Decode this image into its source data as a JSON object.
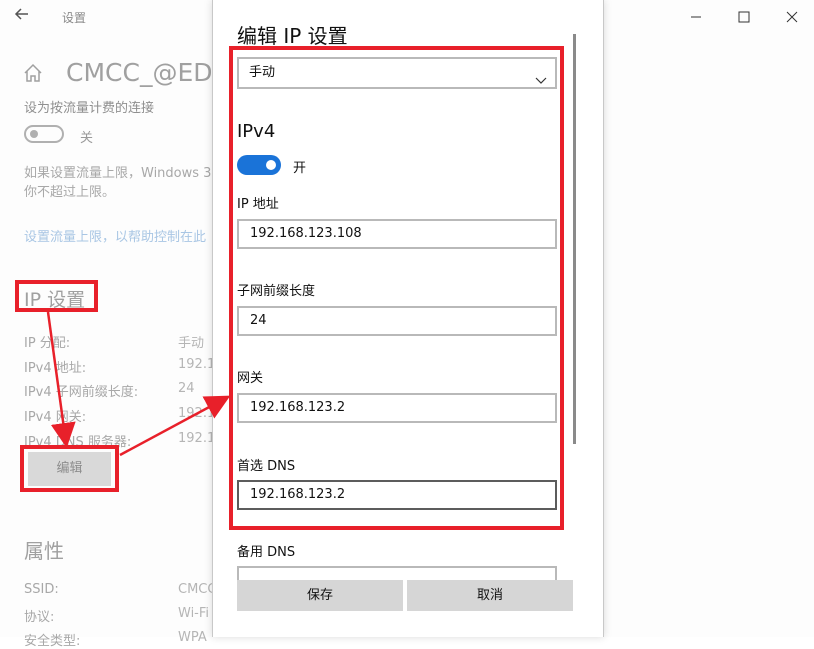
{
  "window": {
    "title": "设置",
    "back_icon": "back-arrow-icon"
  },
  "background": {
    "network_title": "CMCC_@ED",
    "metered": {
      "label": "设为按流量计费的连接",
      "toggle_text": "关"
    },
    "paragraph_lines": [
      "如果设置流量上限，Windows 3",
      "你不超过上限。"
    ],
    "link": "设置流量上限，以帮助控制在此",
    "ip_settings": {
      "heading": "IP 设置",
      "rows": [
        {
          "label": "IP 分配:",
          "value": "手动"
        },
        {
          "label": "IPv4 地址:",
          "value": "192.16"
        },
        {
          "label": "IPv4 子网前缀长度:",
          "value": "24"
        },
        {
          "label": "IPv4 网关:",
          "value": "192.16"
        },
        {
          "label": "IPv4 DNS 服务器:",
          "value": "192.16"
        }
      ],
      "edit_button": "编辑"
    },
    "properties": {
      "heading": "属性",
      "rows": [
        {
          "label": "SSID:",
          "value": "CMCC"
        },
        {
          "label": "协议:",
          "value": "Wi-Fi"
        },
        {
          "label": "安全类型:",
          "value": "WPA"
        }
      ]
    }
  },
  "dialog": {
    "title": "编辑 IP 设置",
    "mode_select": "手动",
    "ipv4": {
      "heading": "IPv4",
      "toggle_text": "开"
    },
    "fields": [
      {
        "label": "IP 地址",
        "value": "192.168.123.108"
      },
      {
        "label": "子网前缀长度",
        "value": "24"
      },
      {
        "label": "网关",
        "value": "192.168.123.2"
      },
      {
        "label": "首选 DNS",
        "value": "192.168.123.2"
      },
      {
        "label": "备用 DNS",
        "value": ""
      }
    ],
    "save_button": "保存",
    "cancel_button": "取消"
  },
  "colors": {
    "accent": "#1a73d8",
    "annotation": "#e8202a"
  }
}
